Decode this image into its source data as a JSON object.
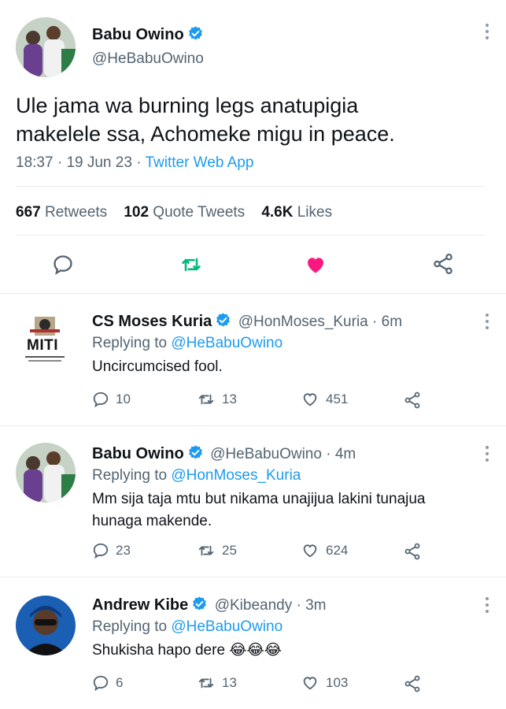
{
  "main_tweet": {
    "author_name": "Babu Owino",
    "author_handle": "@HeBabuOwino",
    "text_line1": "Ule jama wa burning legs anatupigia",
    "text_line2": "makelele ssa, Achomeke migu in peace.",
    "time": "18:37",
    "date": "19 Jun 23",
    "separator": "·",
    "app": "Twitter Web App",
    "retweets_count": "667",
    "retweets_label": "Retweets",
    "quotes_count": "102",
    "quotes_label": "Quote Tweets",
    "likes_count": "4.6K",
    "likes_label": "Likes"
  },
  "replies": [
    {
      "author_name": "CS Moses Kuria",
      "author_handle": "@HonMoses_Kuria · 6m",
      "replying_prefix": "Replying to",
      "replying_to": "@HeBabuOwino",
      "text": "Uncircumcised fool.",
      "avatar_text": "MITI",
      "replies": "10",
      "retweets": "13",
      "likes": "451"
    },
    {
      "author_name": "Babu Owino",
      "author_handle": "@HeBabuOwino · 4m",
      "replying_prefix": "Replying to",
      "replying_to": "@HonMoses_Kuria",
      "text_line1": "Mm sija taja mtu but nikama unajijua lakini tunajua",
      "text_line2": "hunaga makende.",
      "replies": "23",
      "retweets": "25",
      "likes": "624"
    },
    {
      "author_name": "Andrew Kibe",
      "author_handle": "@Kibeandy · 3m",
      "replying_prefix": "Replying to",
      "replying_to": "@HeBabuOwino",
      "text": "Shukisha hapo dere 😂😂😂",
      "replies": "6",
      "retweets": "13",
      "likes": "103"
    }
  ],
  "colors": {
    "accent": "#1d9bf0",
    "like": "#f91880",
    "retweet": "#00ba7c",
    "muted": "#536471"
  }
}
